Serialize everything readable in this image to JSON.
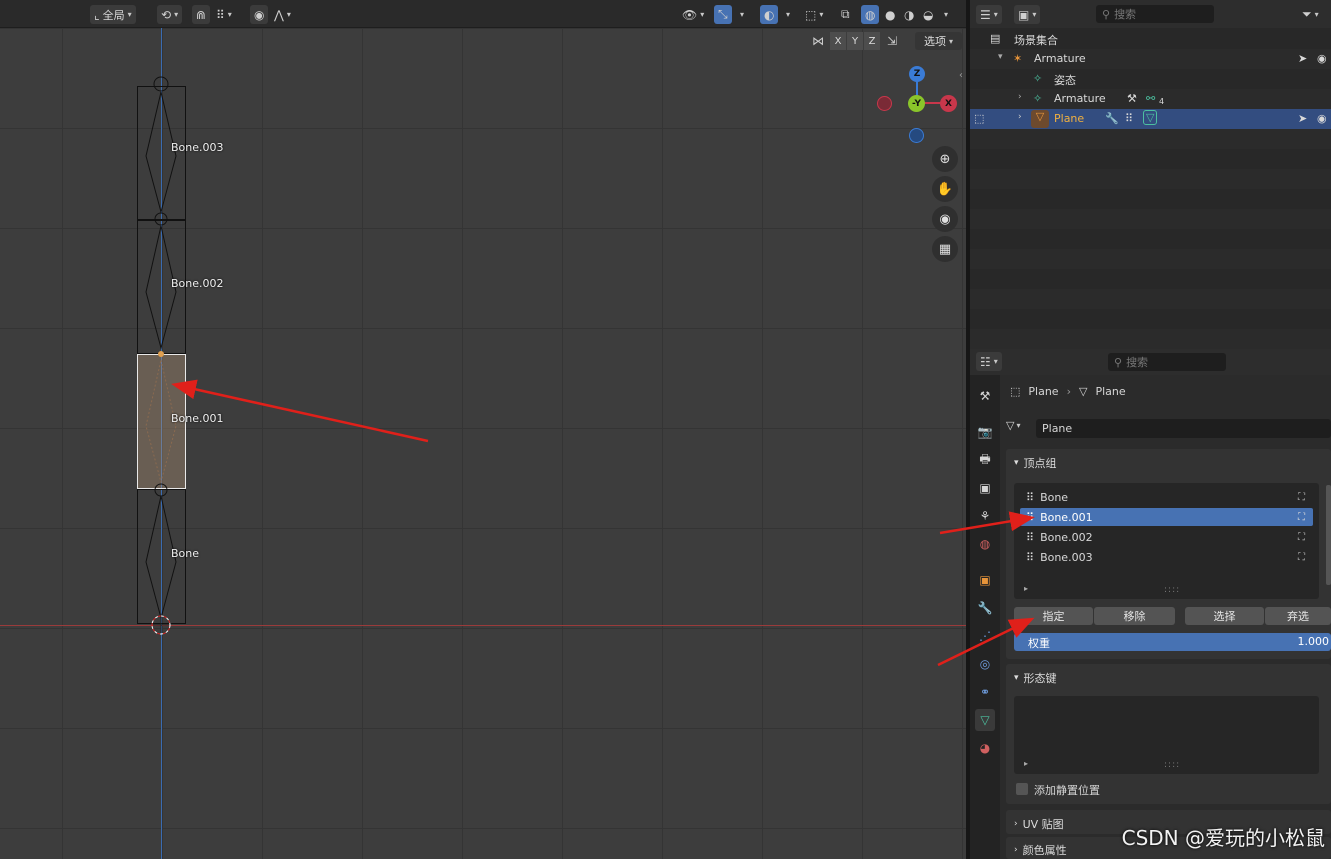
{
  "viewport": {
    "header": {
      "transform_orientation": "全局",
      "options_label": "选项"
    },
    "axis_buttons": [
      "X",
      "Y",
      "Z"
    ],
    "bones": [
      {
        "name": "Bone.003"
      },
      {
        "name": "Bone.002"
      },
      {
        "name": "Bone.001",
        "selected": true
      },
      {
        "name": "Bone"
      }
    ],
    "gizmo": {
      "z": "Z",
      "y": "-Y",
      "x": "X"
    },
    "colors": {
      "x_axis": "#c8374b",
      "y_axis": "#8ac52a",
      "z_axis": "#3a7bd5",
      "annotation_arrow": "#e0201a"
    }
  },
  "outliner": {
    "search_placeholder": "搜索",
    "root": "场景集合",
    "rows": [
      {
        "name": "Armature",
        "level": 1,
        "icon": "armature-icon"
      },
      {
        "name": "姿态",
        "level": 2,
        "icon": "pose-icon"
      },
      {
        "name": "Armature",
        "level": 2,
        "icon": "armature-data-icon"
      },
      {
        "name": "Plane",
        "level": 2,
        "icon": "mesh-icon",
        "selected": true
      }
    ],
    "badge_count": "4"
  },
  "properties": {
    "search_placeholder": "搜索",
    "breadcrumb": [
      "Plane",
      "Plane"
    ],
    "mesh_name": "Plane",
    "vertex_groups": {
      "title": "顶点组",
      "items": [
        "Bone",
        "Bone.001",
        "Bone.002",
        "Bone.003"
      ],
      "selected_index": 1,
      "buttons": {
        "assign": "指定",
        "remove": "移除",
        "select": "选择",
        "deselect": "弃选"
      },
      "weight_label": "权重",
      "weight_value": "1.000"
    },
    "shape_keys": {
      "title": "形态键",
      "add_rest": "添加静置位置"
    },
    "uv_maps": {
      "title": "UV 贴图"
    },
    "color_attributes": {
      "title": "颜色属性"
    }
  },
  "watermark": "CSDN @爱玩的小松鼠"
}
